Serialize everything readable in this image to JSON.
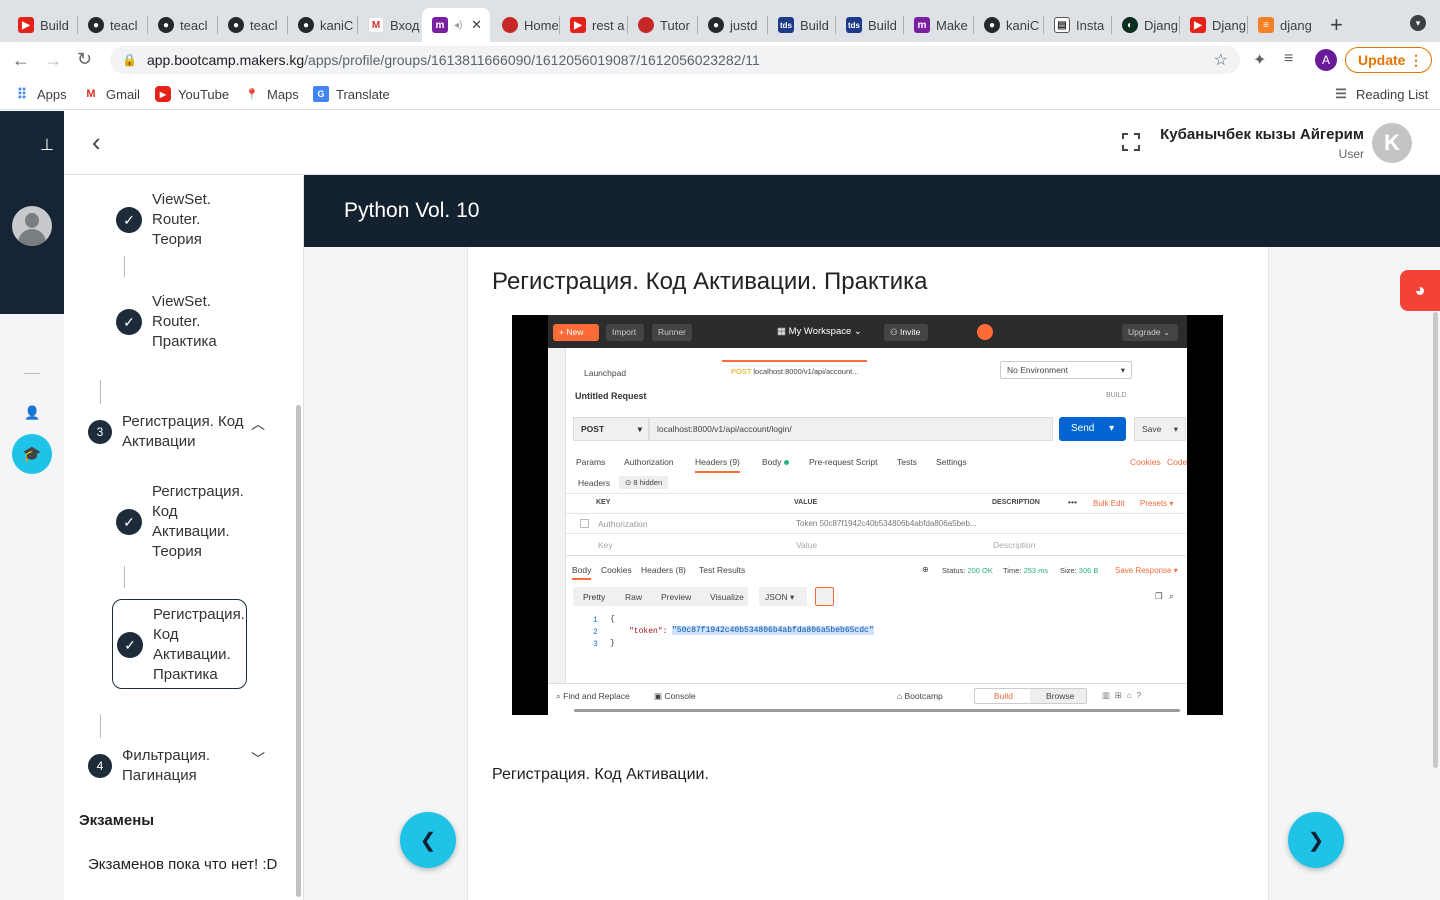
{
  "browser": {
    "tabs": [
      {
        "label": "Build",
        "icon": "youtube-icon"
      },
      {
        "label": "teacl",
        "icon": "github-icon"
      },
      {
        "label": "teacl",
        "icon": "github-icon"
      },
      {
        "label": "teacl",
        "icon": "github-icon"
      },
      {
        "label": "kaniC",
        "icon": "github-icon"
      },
      {
        "label": "Вход",
        "icon": "gmail-icon"
      },
      {
        "label": "",
        "icon": "makers-icon",
        "active": true
      },
      {
        "label": "Home",
        "icon": "red-icon"
      },
      {
        "label": "rest a",
        "icon": "youtube-icon"
      },
      {
        "label": "Tutor",
        "icon": "red-icon"
      },
      {
        "label": "justd",
        "icon": "github-icon"
      },
      {
        "label": "Build",
        "icon": "tds-icon"
      },
      {
        "label": "Build",
        "icon": "tds-icon"
      },
      {
        "label": "Make",
        "icon": "makers-icon"
      },
      {
        "label": "kaniC",
        "icon": "github-icon"
      },
      {
        "label": "Insta",
        "icon": "document-icon"
      },
      {
        "label": "Djang",
        "icon": "django-icon"
      },
      {
        "label": "Djang",
        "icon": "youtube-icon"
      },
      {
        "label": "djang",
        "icon": "stackoverflow-icon"
      }
    ],
    "url_host": "app.bootcamp.makers.kg",
    "url_path": "/apps/profile/groups/1613811666090/1612056019087/1612056023282/11",
    "profile_initial": "A",
    "update_label": "Update",
    "bookmarks": [
      {
        "label": "Apps",
        "icon": "apps-grid-icon"
      },
      {
        "label": "Gmail",
        "icon": "gmail-icon"
      },
      {
        "label": "YouTube",
        "icon": "youtube-icon"
      },
      {
        "label": "Maps",
        "icon": "maps-pin-icon"
      },
      {
        "label": "Translate",
        "icon": "translate-icon"
      }
    ],
    "reading_list": "Reading List"
  },
  "header": {
    "user_name": "Кубанычбек кызы Айгерим",
    "user_role": "User",
    "avatar_letter": "K"
  },
  "sidebar": {
    "lessons_top": [
      {
        "label": "ViewSet. Router. Теория"
      },
      {
        "label": "ViewSet. Router. Практика"
      }
    ],
    "module3": {
      "number": "3",
      "label": "Регистрация. Код Активации"
    },
    "module3_lessons": [
      {
        "label": "Регистрация. Код Активации. Теория"
      },
      {
        "label": "Регистрация. Код Активации. Практика",
        "current": true
      }
    ],
    "module4": {
      "number": "4",
      "label": "Фильтрация. Пагинация"
    },
    "exams_title": "Экзамены",
    "exams_empty": "Экзаменов пока что нет! :D"
  },
  "main": {
    "course_title": "Python Vol. 10",
    "lesson_title": "Регистрация. Код Активации. Практика",
    "lesson_text": "Регистрация. Код Активации."
  },
  "video": {
    "new": "New",
    "import": "Import",
    "runner": "Runner",
    "workspace": "My Workspace",
    "invite": "Invite",
    "upgrade": "Upgrade",
    "tab_launchpad": "Launchpad",
    "tab_method": "POST",
    "tab_url": "localhost:8000/v1/api/account...",
    "environment": "No Environment",
    "request_name": "Untitled Request",
    "build": "BUILD",
    "method": "POST",
    "url": "localhost:8000/v1/api/account/login/",
    "send": "Send",
    "save": "Save",
    "req_tabs": [
      "Params",
      "Authorization",
      "Headers (9)",
      "Body",
      "Pre-request Script",
      "Tests",
      "Settings"
    ],
    "cookies": "Cookies",
    "code": "Code",
    "headers_label": "Headers",
    "hidden": "8 hidden",
    "col_key": "KEY",
    "col_value": "VALUE",
    "col_desc": "DESCRIPTION",
    "bulk_edit": "Bulk Edit",
    "presets": "Presets",
    "row_key": "Authorization",
    "row_value": "Token 50c87f1942c40b534806b4abfda806a5beb...",
    "ph_key": "Key",
    "ph_value": "Value",
    "ph_desc": "Description",
    "resp_tabs": [
      "Body",
      "Cookies",
      "Headers (8)",
      "Test Results"
    ],
    "status_label": "Status:",
    "status": "200 OK",
    "time_label": "Time:",
    "time": "253 ms",
    "size_label": "Size:",
    "size": "306 B",
    "save_response": "Save Response",
    "view_tabs": [
      "Pretty",
      "Raw",
      "Preview",
      "Visualize"
    ],
    "format": "JSON",
    "line1": "{",
    "token_key": "\"token\":",
    "token_value": "\"50c87f1942c40b534806b4abfda806a5beb65cdc\"",
    "line3": "}",
    "find_replace": "Find and Replace",
    "console": "Console",
    "bootcamp": "Bootcamp",
    "build_tab": "Build",
    "browse_tab": "Browse"
  }
}
